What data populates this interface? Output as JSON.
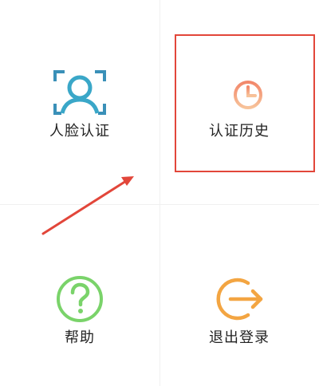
{
  "menu": {
    "face_auth_label": "人脸认证",
    "auth_history_label": "认证历史",
    "help_label": "帮助",
    "logout_label": "退出登录"
  },
  "icons": {
    "face_auth": "face-scan-icon",
    "auth_history": "history-clock-icon",
    "help": "question-circle-icon",
    "logout": "logout-arrow-icon"
  },
  "colors": {
    "face_icon": "#3a90b8",
    "history_icon_top": "#f2876a",
    "history_icon_bottom": "#f7c39a",
    "help_icon": "#7ad36a",
    "logout_icon": "#f3a542",
    "annotation": "#e2463a"
  }
}
